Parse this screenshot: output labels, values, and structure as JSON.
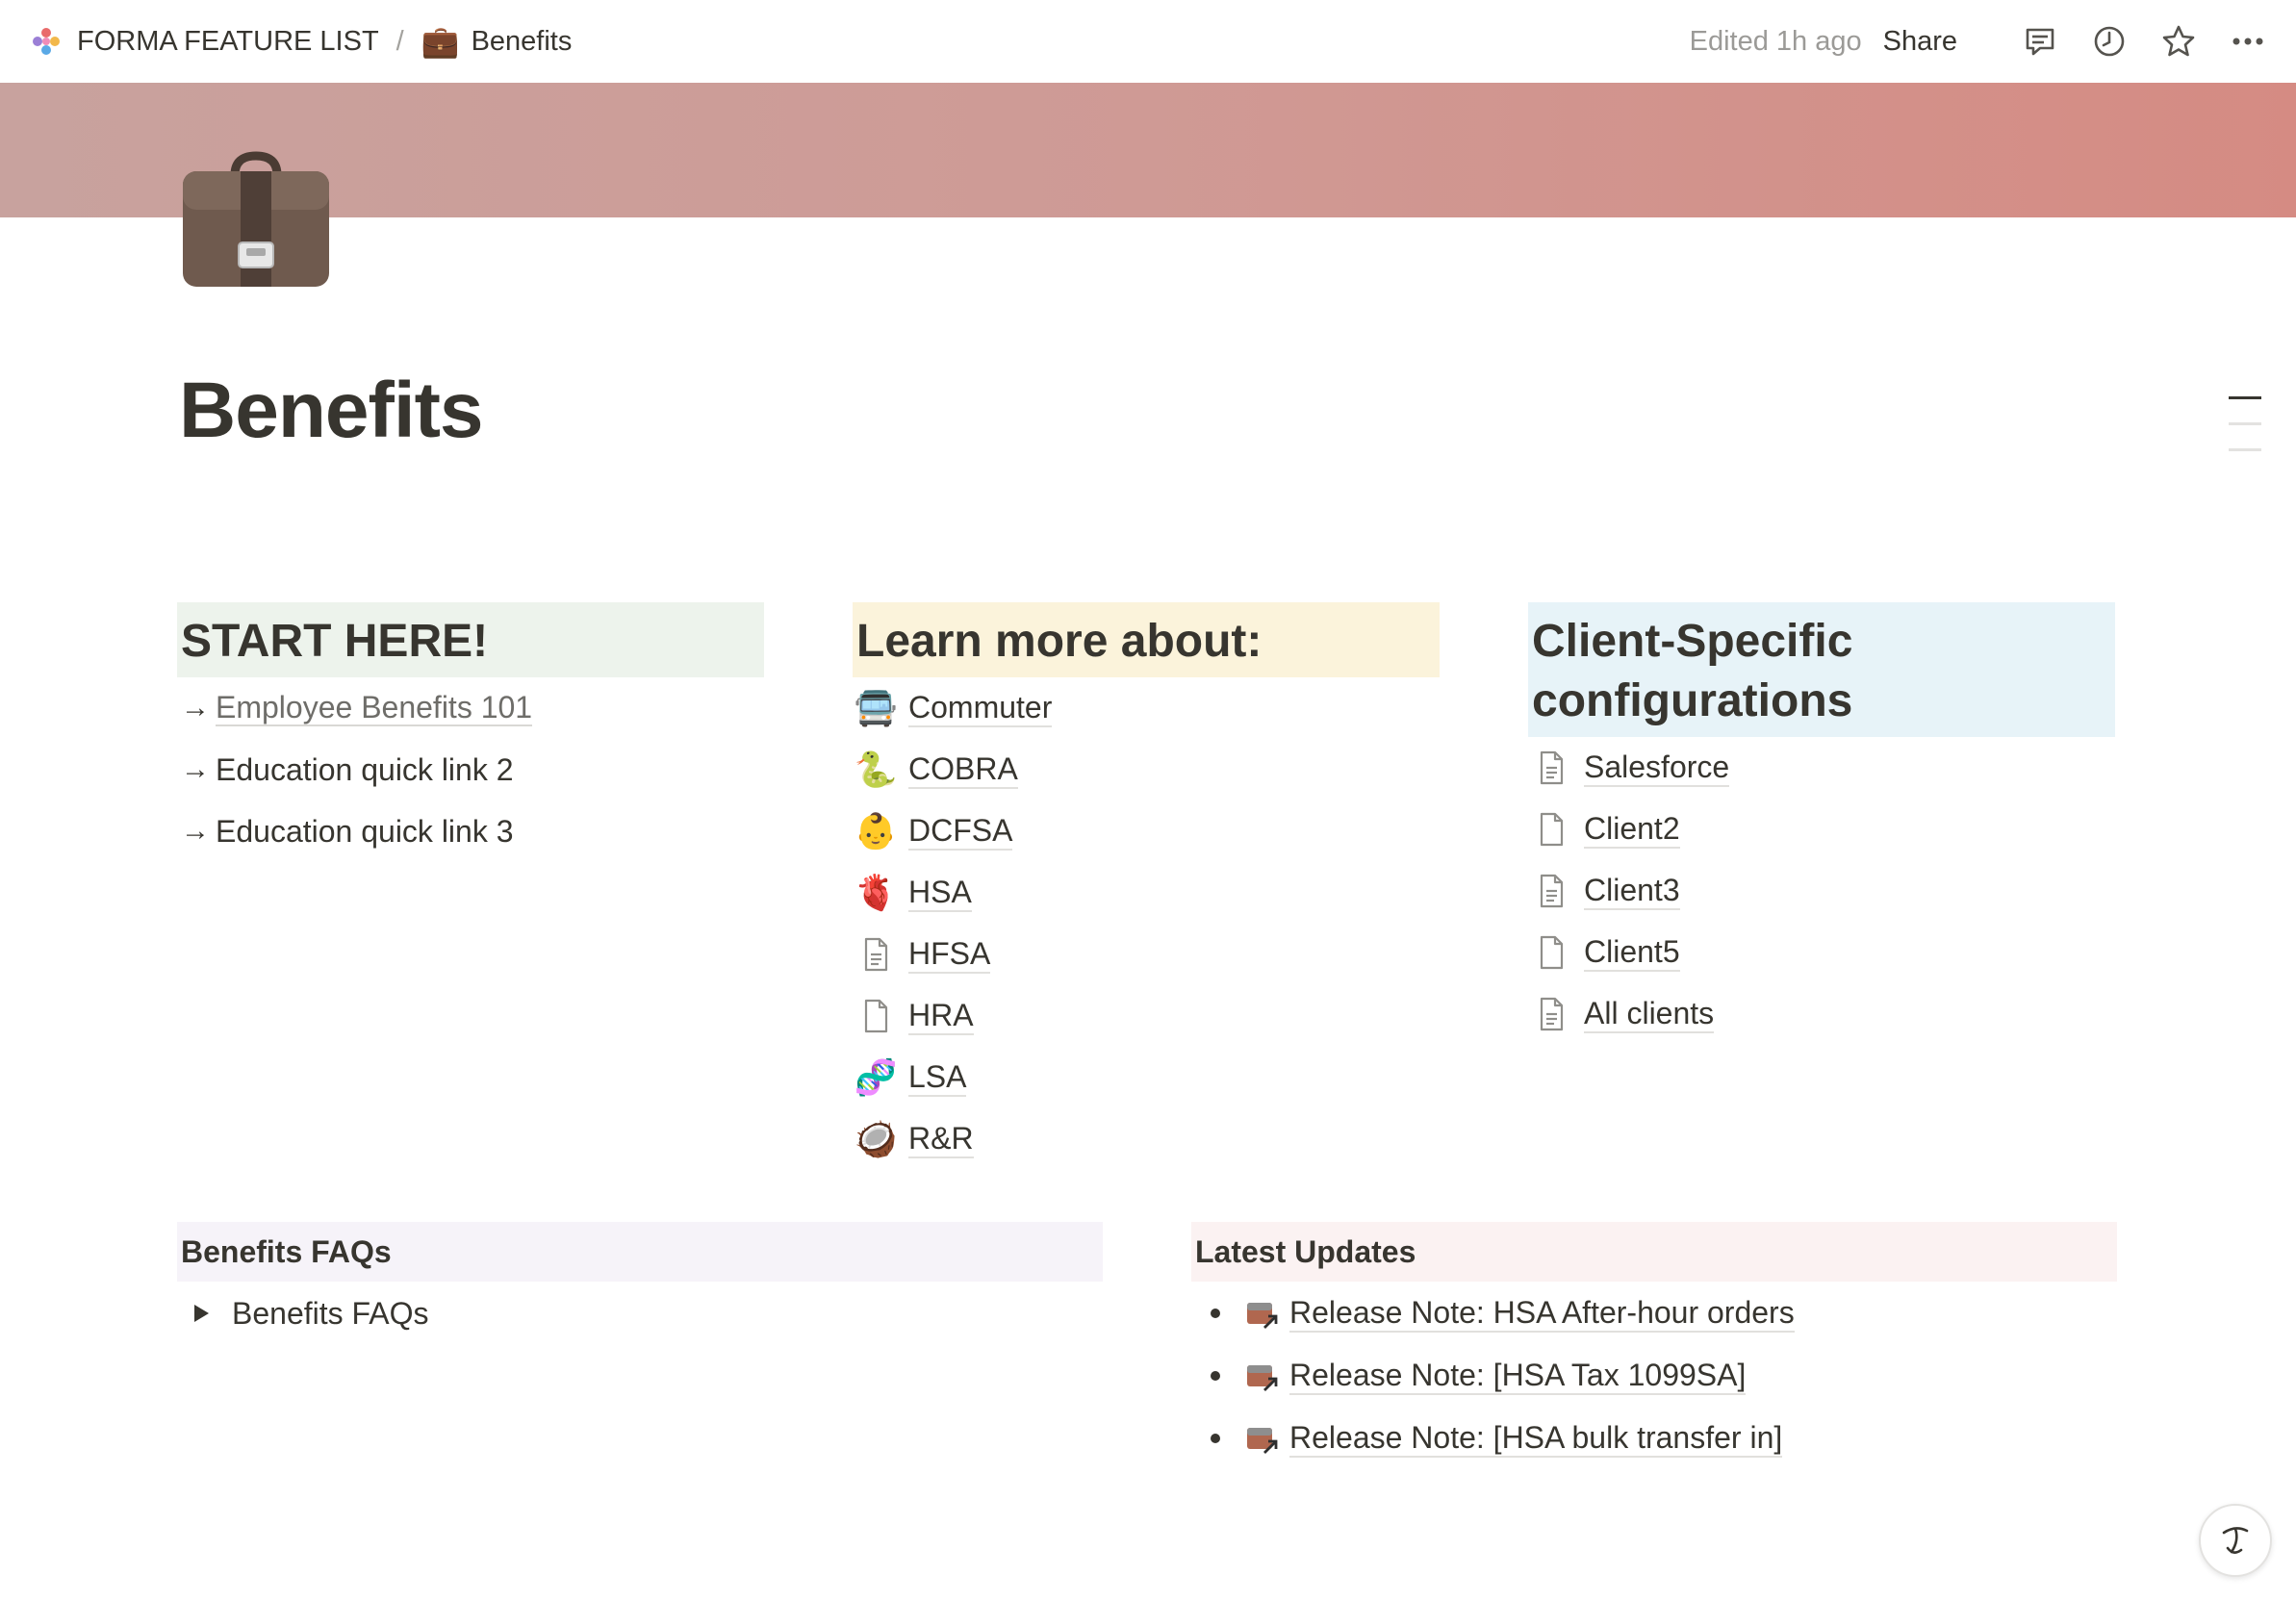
{
  "topbar": {
    "workspace": "FORMA FEATURE LIST",
    "separator": "/",
    "page_icon": "💼",
    "page": "Benefits",
    "edited": "Edited 1h ago",
    "share": "Share",
    "icons": [
      "comments-icon",
      "clock-icon",
      "star-icon",
      "more-icon"
    ]
  },
  "page": {
    "icon": "briefcase-icon",
    "title": "Benefits"
  },
  "columns": {
    "start": {
      "heading": "START HERE!",
      "items": [
        {
          "arrow": "→",
          "label": "Employee Benefits 101"
        },
        {
          "arrow": "→",
          "label": "Education quick link 2"
        },
        {
          "arrow": "→",
          "label": "Education quick link 3"
        }
      ]
    },
    "learn": {
      "heading": "Learn more about:",
      "items": [
        {
          "emoji": "🚍",
          "label": "Commuter"
        },
        {
          "emoji": "🐍",
          "label": "COBRA"
        },
        {
          "emoji": "👶",
          "label": "DCFSA"
        },
        {
          "emoji": "🫀",
          "label": "HSA"
        },
        {
          "emoji": "",
          "label": "HFSA"
        },
        {
          "emoji": "",
          "label": "HRA"
        },
        {
          "emoji": "🧬",
          "label": "LSA"
        },
        {
          "emoji": "🥥",
          "label": "R&R"
        }
      ]
    },
    "clients": {
      "heading": "Client-Specific configurations",
      "items": [
        {
          "label": "Salesforce"
        },
        {
          "label": "Client2"
        },
        {
          "label": "Client3"
        },
        {
          "label": "Client5"
        },
        {
          "label": "All clients"
        }
      ]
    }
  },
  "faqs": {
    "heading": "Benefits FAQs",
    "toggle": "Benefits FAQs"
  },
  "updates": {
    "heading": "Latest Updates",
    "items": [
      "Release Note: HSA After-hour orders",
      "Release Note: [HSA Tax 1099SA]",
      "Release Note: [HSA bulk transfer in]"
    ]
  },
  "colors": {
    "text": "#37352f",
    "green_block": "#edf3ec",
    "yellow_block": "#fbf3db",
    "blue_block": "#e7f3f8",
    "purple_block": "#f6f3f9",
    "pink_block": "#fbf2f2"
  }
}
